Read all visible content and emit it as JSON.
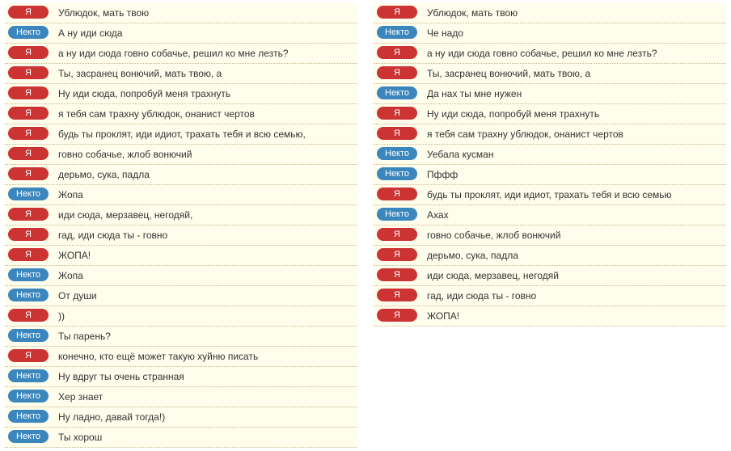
{
  "labels": {
    "me": "Я",
    "other": "Некто"
  },
  "columns": [
    [
      {
        "who": "me",
        "text": "Ублюдок, мать твою"
      },
      {
        "who": "other",
        "text": "А ну иди сюда"
      },
      {
        "who": "me",
        "text": "а ну иди сюда говно собачье, решил ко мне лезть?"
      },
      {
        "who": "me",
        "text": "Ты, засранец вонючий, мать твою, а"
      },
      {
        "who": "me",
        "text": "Ну иди сюда, попробуй меня трахнуть"
      },
      {
        "who": "me",
        "text": "я тебя сам трахну ублюдок, онанист чертов"
      },
      {
        "who": "me",
        "text": "будь ты проклят, иди идиот, трахать тебя и всю семью,"
      },
      {
        "who": "me",
        "text": "говно собачье, жлоб вонючий"
      },
      {
        "who": "me",
        "text": "дерьмо, сука, падла"
      },
      {
        "who": "other",
        "text": "Жопа"
      },
      {
        "who": "me",
        "text": "иди сюда, мерзавец, негодяй,"
      },
      {
        "who": "me",
        "text": "гад, иди сюда ты - говно"
      },
      {
        "who": "me",
        "text": "ЖОПА!"
      },
      {
        "who": "other",
        "text": "Жопа"
      },
      {
        "who": "other",
        "text": "От души"
      },
      {
        "who": "me",
        "text": "))"
      },
      {
        "who": "other",
        "text": "Ты парень?"
      },
      {
        "who": "me",
        "text": "конечно, кто ещё может такую хуйню писать"
      },
      {
        "who": "other",
        "text": "Ну вдруг ты очень странная"
      },
      {
        "who": "other",
        "text": "Хер знает"
      },
      {
        "who": "other",
        "text": "Ну ладно, давай тогда!)"
      },
      {
        "who": "other",
        "text": "Ты хорош"
      }
    ],
    [
      {
        "who": "me",
        "text": "Ублюдок, мать твою"
      },
      {
        "who": "other",
        "text": "Че надо"
      },
      {
        "who": "me",
        "text": "а ну иди сюда говно собачье, решил ко мне лезть?"
      },
      {
        "who": "me",
        "text": "Ты, засранец вонючий, мать твою, а"
      },
      {
        "who": "other",
        "text": "Да нах ты мне нужен"
      },
      {
        "who": "me",
        "text": "Ну иди сюда, попробуй меня трахнуть"
      },
      {
        "who": "me",
        "text": "я тебя сам трахну ублюдок, онанист чертов"
      },
      {
        "who": "other",
        "text": "Уебала кусман"
      },
      {
        "who": "other",
        "text": "Пффф"
      },
      {
        "who": "me",
        "text": "будь ты проклят, иди идиот, трахать тебя и всю семью"
      },
      {
        "who": "other",
        "text": "Ахах"
      },
      {
        "who": "me",
        "text": "говно собачье, жлоб вонючий"
      },
      {
        "who": "me",
        "text": "дерьмо, сука, падла"
      },
      {
        "who": "me",
        "text": "иди сюда, мерзавец, негодяй"
      },
      {
        "who": "me",
        "text": "гад, иди сюда ты - говно"
      },
      {
        "who": "me",
        "text": "ЖОПА!"
      }
    ]
  ]
}
